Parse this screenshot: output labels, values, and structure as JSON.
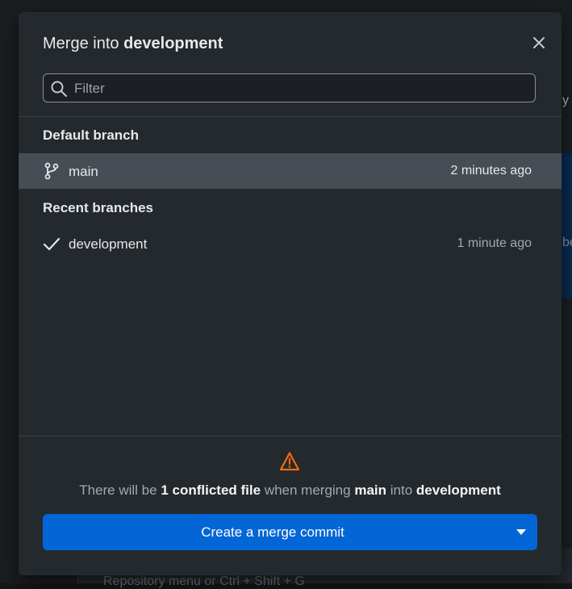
{
  "dialog": {
    "title_prefix": "Merge into",
    "title_branch": "development",
    "close_icon": "close-icon"
  },
  "filter": {
    "placeholder": "Filter",
    "value": ""
  },
  "default_section": {
    "heading": "Default branch",
    "branches": [
      {
        "name": "main",
        "time": "2 minutes ago",
        "icon": "git-branch-icon",
        "selected": true
      }
    ]
  },
  "recent_section": {
    "heading": "Recent branches",
    "branches": [
      {
        "name": "development",
        "time": "1 minute ago",
        "icon": "check-icon",
        "selected": false
      }
    ]
  },
  "merge_info": {
    "part1": "There will be",
    "conflicts": "1 conflicted file",
    "part2": "when merging",
    "source": "main",
    "part3": "into",
    "target": "development"
  },
  "merge_button": {
    "label": "Create a merge commit"
  },
  "background": {
    "hint_y": "y",
    "hint_be": "be",
    "footer_text": "Repository menu or Ctrl + Shift + G"
  },
  "colors": {
    "accent": "#0366d6",
    "warning": "#f66a0a",
    "dialog_bg": "#24292e",
    "selected_row": "#464d55"
  }
}
